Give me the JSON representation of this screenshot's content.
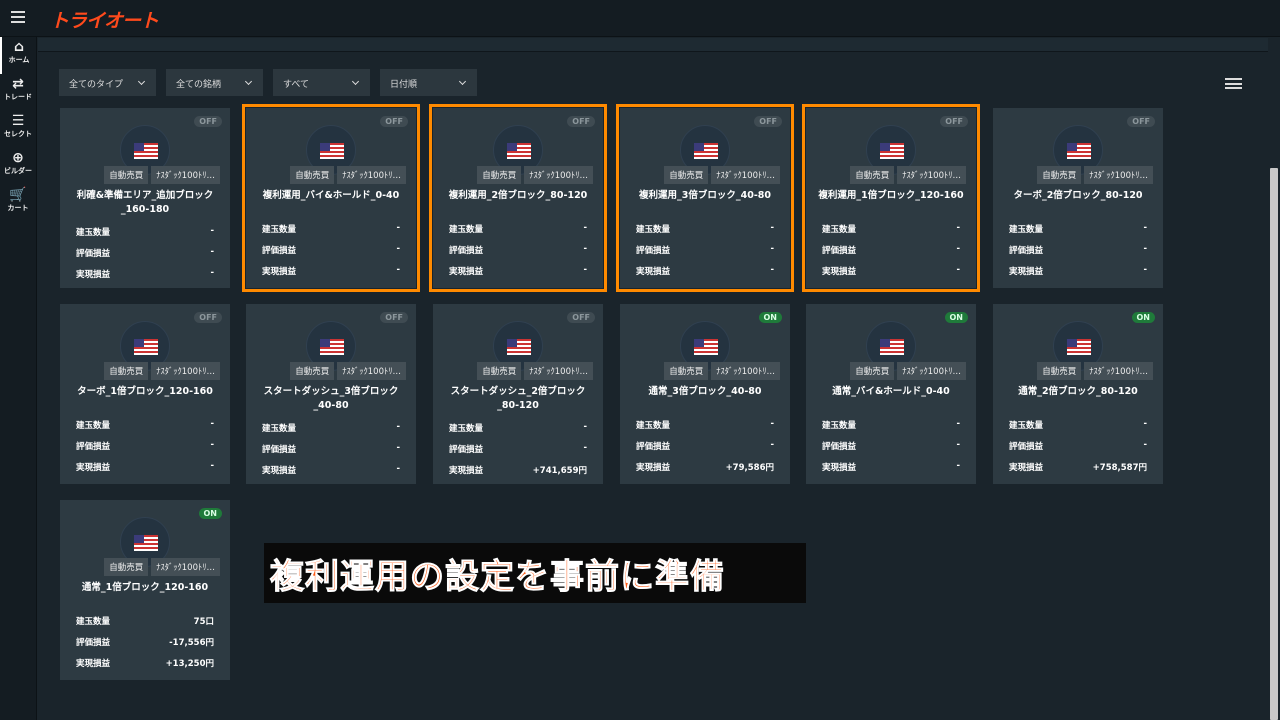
{
  "header": {
    "logo": "トライオート"
  },
  "sidebar": [
    {
      "label": "ホーム",
      "icon": "home-icon",
      "glyph": "⌂"
    },
    {
      "label": "トレード",
      "icon": "trade-icon",
      "glyph": "⇄"
    },
    {
      "label": "セレクト",
      "icon": "select-icon",
      "glyph": "☰"
    },
    {
      "label": "ビルダー",
      "icon": "builder-icon",
      "glyph": "⊕"
    },
    {
      "label": "カート",
      "icon": "cart-icon",
      "glyph": "🛒"
    }
  ],
  "filters": [
    "全てのタイプ",
    "全ての銘柄",
    "すべて",
    "日付順"
  ],
  "labels": {
    "qty": "建玉数量",
    "unrealized": "評価損益",
    "realized": "実現損益",
    "tag1": "自動売買",
    "tag2": "ﾅｽﾀﾞｯｸ100ﾄﾘ…"
  },
  "cards": [
    {
      "title": "利確&準備エリア_追加ブロック_160-180",
      "status": "OFF",
      "qty": "-",
      "unrealized": "-",
      "realized": "-",
      "highlight": false
    },
    {
      "title": "複利運用_バイ&ホールド_0-40",
      "status": "OFF",
      "qty": "-",
      "unrealized": "-",
      "realized": "-",
      "highlight": true
    },
    {
      "title": "複利運用_2倍ブロック_80-120",
      "status": "OFF",
      "qty": "-",
      "unrealized": "-",
      "realized": "-",
      "highlight": true
    },
    {
      "title": "複利運用_3倍ブロック_40-80",
      "status": "OFF",
      "qty": "-",
      "unrealized": "-",
      "realized": "-",
      "highlight": true
    },
    {
      "title": "複利運用_1倍ブロック_120-160",
      "status": "OFF",
      "qty": "-",
      "unrealized": "-",
      "realized": "-",
      "highlight": true
    },
    {
      "title": "ターボ_2倍ブロック_80-120",
      "status": "OFF",
      "qty": "-",
      "unrealized": "-",
      "realized": "-",
      "highlight": false
    },
    {
      "title": "ターボ_1倍ブロック_120-160",
      "status": "OFF",
      "qty": "-",
      "unrealized": "-",
      "realized": "-",
      "highlight": false
    },
    {
      "title": "スタートダッシュ_3倍ブロック_40-80",
      "status": "OFF",
      "qty": "-",
      "unrealized": "-",
      "realized": "-",
      "highlight": false
    },
    {
      "title": "スタートダッシュ_2倍ブロック_80-120",
      "status": "OFF",
      "qty": "-",
      "unrealized": "-",
      "realized": "+741,659円",
      "highlight": false
    },
    {
      "title": "通常_3倍ブロック_40-80",
      "status": "ON",
      "qty": "-",
      "unrealized": "-",
      "realized": "+79,586円",
      "highlight": false
    },
    {
      "title": "通常_バイ&ホールド_0-40",
      "status": "ON",
      "qty": "-",
      "unrealized": "-",
      "realized": "-",
      "highlight": false
    },
    {
      "title": "通常_2倍ブロック_80-120",
      "status": "ON",
      "qty": "-",
      "unrealized": "-",
      "realized": "+758,587円",
      "highlight": false
    },
    {
      "title": "通常_1倍ブロック_120-160",
      "status": "ON",
      "qty": "75口",
      "unrealized": "-17,556円",
      "realized": "+13,250円",
      "highlight": false
    }
  ],
  "caption": "複利運用の設定を事前に準備"
}
